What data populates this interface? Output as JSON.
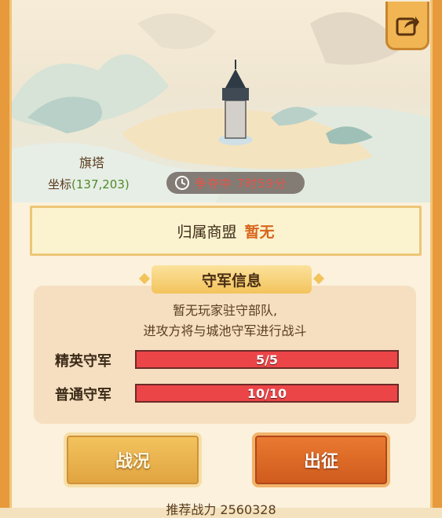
{
  "tower": {
    "name": "旗塔",
    "coord_label": "坐标",
    "coord_value": "(137,203)"
  },
  "timer": {
    "text": "争夺中 7时59分"
  },
  "alliance": {
    "label": "归属商盟",
    "value": "暂无"
  },
  "defense": {
    "title": "守军信息",
    "desc_line1": "暂无玩家驻守部队,",
    "desc_line2": "进攻方将与城池守军进行战斗",
    "rows": [
      {
        "label": "精英守军",
        "text": "5/5",
        "fill": 1.0
      },
      {
        "label": "普通守军",
        "text": "10/10",
        "fill": 1.0
      }
    ]
  },
  "buttons": {
    "battle": "战况",
    "march": "出征"
  },
  "footer": {
    "text": "推荐战力 2560328"
  },
  "colors": {
    "accent_orange": "#d8651d",
    "coord_green": "#4f8a28",
    "bar_red": "#ec4548",
    "timer_red": "#e4483b"
  }
}
